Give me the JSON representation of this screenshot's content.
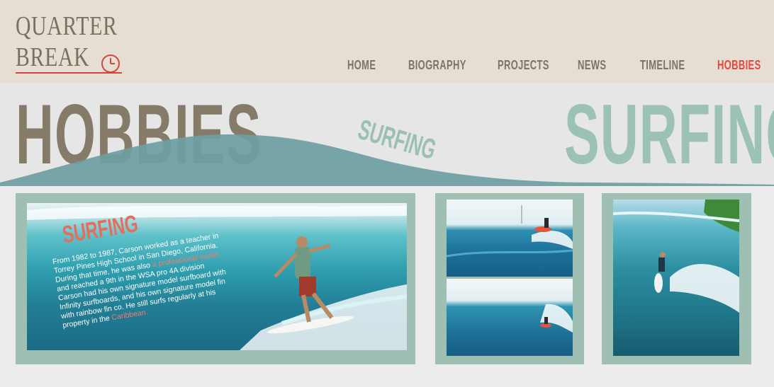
{
  "logo": {
    "line1": "QUARTER",
    "line2": "BREAK"
  },
  "nav": {
    "items": [
      {
        "label": "HOME"
      },
      {
        "label": "BIOGRAPHY"
      },
      {
        "label": "PROJECTS"
      },
      {
        "label": "NEWS"
      },
      {
        "label": "TIMELINE"
      },
      {
        "label": "HOBBIES",
        "active": true
      }
    ]
  },
  "banner": {
    "title": "HOBBIES",
    "tilted_word": "SURFING",
    "right_word": "SURFING"
  },
  "caption": {
    "title": "SURFING",
    "text_before": "From 1982 to 1987, Carson worked as a teacher in Torrey Pines High School in San Diego, California. During that time, he was also ",
    "highlight1": "a professional surfer,",
    "text_after": " and reached a 9th in the WSA pro 4A division Carson had his own signature model surfboard with Infinity surfboards, and his own signature model fin with rainbow fin co. He still surfs regularly at his property in the ",
    "highlight2": "Caribbean."
  },
  "colors": {
    "header_bg": "#e6ded3",
    "accent_red": "#e04a3f",
    "nav_text": "#7d7466",
    "frame": "#9fbfb2",
    "wave": "#6e9ea1"
  },
  "icons": {
    "logo_clock": "clock-icon"
  }
}
